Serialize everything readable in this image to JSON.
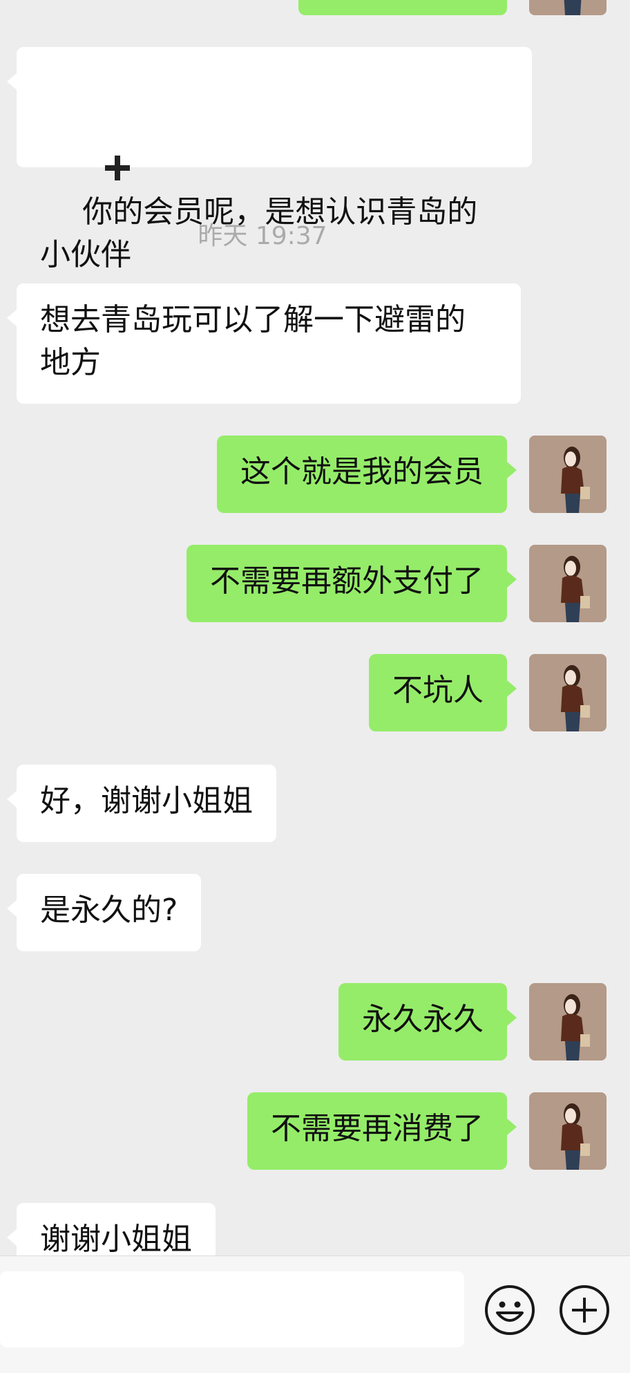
{
  "messages": [
    {
      "side": "in",
      "text": "你的会员呢，是想认识青岛的\n小伙伴",
      "prefix_icon": "plus-icon",
      "suffix_emoji": "laughing-tears-emoji"
    },
    {
      "timestamp": "昨天 19:37"
    },
    {
      "side": "in",
      "text": "想去青岛玩可以了解一下避雷的\n地方"
    },
    {
      "side": "out",
      "text": "这个就是我的会员"
    },
    {
      "side": "out",
      "text": "不需要再额外支付了"
    },
    {
      "side": "out",
      "text": "不坑人"
    },
    {
      "side": "in",
      "text": "好，谢谢小姐姐"
    },
    {
      "side": "in",
      "text": "是永久的?"
    },
    {
      "side": "out",
      "text": "永久永久"
    },
    {
      "side": "out",
      "text": "不需要再消费了"
    },
    {
      "side": "in",
      "text": "谢谢小姐姐"
    }
  ],
  "input_bar": {
    "placeholder": "",
    "emoji_button_icon": "smiley-icon",
    "more_button_icon": "plus-circle-icon"
  },
  "colors": {
    "background": "#ededed",
    "incoming_bubble": "#ffffff",
    "outgoing_bubble": "#95ec69",
    "timestamp_text": "#aaaaaa"
  }
}
